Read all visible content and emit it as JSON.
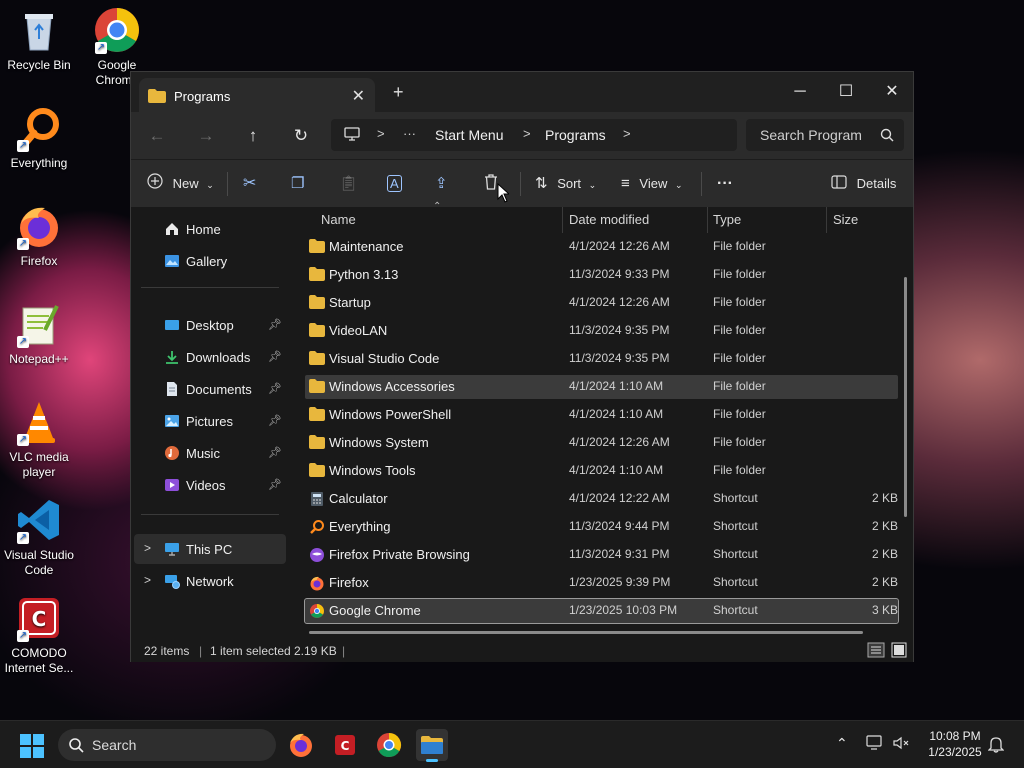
{
  "desktop": {
    "icons": [
      {
        "label": "Recycle Bin",
        "icon": "recycle-bin-icon"
      },
      {
        "label": "Google Chrome",
        "icon": "chrome-icon"
      },
      {
        "label": "Everything",
        "icon": "everything-icon"
      },
      {
        "label": "Firefox",
        "icon": "firefox-icon"
      },
      {
        "label": "Notepad++",
        "icon": "notepadpp-icon"
      },
      {
        "label": "VLC media player",
        "icon": "vlc-icon"
      },
      {
        "label": "Visual Studio Code",
        "icon": "vscode-icon"
      },
      {
        "label": "COMODO Internet Se...",
        "icon": "comodo-icon"
      }
    ]
  },
  "window": {
    "tab_title": "Programs",
    "breadcrumb": [
      "Start Menu",
      "Programs"
    ],
    "search_placeholder": "Search Program",
    "toolbar": {
      "new_label": "New",
      "sort_label": "Sort",
      "view_label": "View",
      "details_label": "Details"
    },
    "nav": {
      "items": [
        {
          "label": "Home",
          "icon": "home-icon"
        },
        {
          "label": "Gallery",
          "icon": "gallery-icon"
        },
        {
          "label": "Desktop",
          "icon": "desktop-icon",
          "pinned": true
        },
        {
          "label": "Downloads",
          "icon": "downloads-icon",
          "pinned": true
        },
        {
          "label": "Documents",
          "icon": "documents-icon",
          "pinned": true
        },
        {
          "label": "Pictures",
          "icon": "pictures-icon",
          "pinned": true
        },
        {
          "label": "Music",
          "icon": "music-icon",
          "pinned": true
        },
        {
          "label": "Videos",
          "icon": "videos-icon",
          "pinned": true
        },
        {
          "label": "This PC",
          "icon": "this-pc-icon"
        },
        {
          "label": "Network",
          "icon": "network-icon"
        }
      ]
    },
    "columns": {
      "name": "Name",
      "date": "Date modified",
      "type": "Type",
      "size": "Size"
    },
    "files": [
      {
        "name": "Maintenance",
        "date": "4/1/2024 12:26 AM",
        "type": "File folder",
        "size": "",
        "icon": "folder-icon"
      },
      {
        "name": "Python 3.13",
        "date": "11/3/2024 9:33 PM",
        "type": "File folder",
        "size": "",
        "icon": "folder-icon"
      },
      {
        "name": "Startup",
        "date": "4/1/2024 12:26 AM",
        "type": "File folder",
        "size": "",
        "icon": "folder-icon"
      },
      {
        "name": "VideoLAN",
        "date": "11/3/2024 9:35 PM",
        "type": "File folder",
        "size": "",
        "icon": "folder-icon"
      },
      {
        "name": "Visual Studio Code",
        "date": "11/3/2024 9:35 PM",
        "type": "File folder",
        "size": "",
        "icon": "folder-icon"
      },
      {
        "name": "Windows Accessories",
        "date": "4/1/2024 1:10 AM",
        "type": "File folder",
        "size": "",
        "icon": "folder-icon"
      },
      {
        "name": "Windows PowerShell",
        "date": "4/1/2024 1:10 AM",
        "type": "File folder",
        "size": "",
        "icon": "folder-icon"
      },
      {
        "name": "Windows System",
        "date": "4/1/2024 12:26 AM",
        "type": "File folder",
        "size": "",
        "icon": "folder-icon"
      },
      {
        "name": "Windows Tools",
        "date": "4/1/2024 1:10 AM",
        "type": "File folder",
        "size": "",
        "icon": "folder-icon"
      },
      {
        "name": "Calculator",
        "date": "4/1/2024 12:22 AM",
        "type": "Shortcut",
        "size": "2 KB",
        "icon": "calculator-icon"
      },
      {
        "name": "Everything",
        "date": "11/3/2024 9:44 PM",
        "type": "Shortcut",
        "size": "2 KB",
        "icon": "everything-icon"
      },
      {
        "name": "Firefox Private Browsing",
        "date": "11/3/2024 9:31 PM",
        "type": "Shortcut",
        "size": "2 KB",
        "icon": "firefox-private-icon"
      },
      {
        "name": "Firefox",
        "date": "1/23/2025 9:39 PM",
        "type": "Shortcut",
        "size": "2 KB",
        "icon": "firefox-icon"
      },
      {
        "name": "Google Chrome",
        "date": "1/23/2025 10:03 PM",
        "type": "Shortcut",
        "size": "3 KB",
        "icon": "chrome-icon"
      }
    ],
    "status": {
      "count": "22 items",
      "selected": "1 item selected",
      "size": "2.19 KB"
    }
  },
  "taskbar": {
    "search_placeholder": "Search",
    "time": "10:08 PM",
    "date": "1/23/2025"
  },
  "colors": {
    "window_bg": "#191919",
    "toolbar_bg": "#2b2b2b",
    "folder": "#e8b73d",
    "accent": "#4cc2ff"
  }
}
